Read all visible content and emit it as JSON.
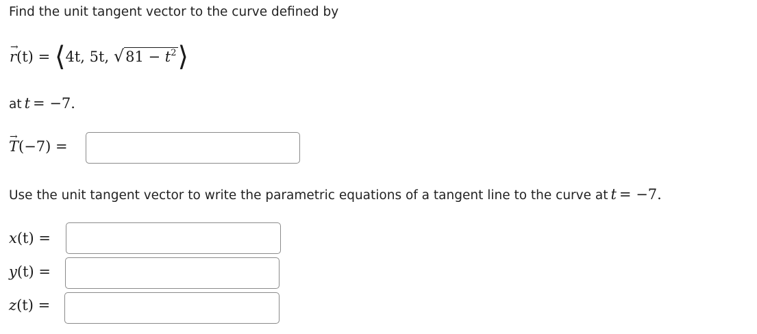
{
  "question": {
    "intro_text": "Find the unit tangent vector to the curve defined by",
    "curve": {
      "lhs_vec": "r",
      "lhs_arg": "(t)",
      "equals": "=",
      "comp1": "4t,",
      "comp2": "5t,",
      "radicand_const": "81 −",
      "radicand_var": "t",
      "radicand_exp": "2"
    },
    "at_text": "at",
    "at_var": "t",
    "at_value": "= −7.",
    "tangent_vec": "T",
    "tangent_arg": "(−7)",
    "tangent_equals": "="
  },
  "line_section": {
    "instruction_text": "Use the unit tangent vector to write the parametric equations of a tangent line to the curve at",
    "instruction_var": "t",
    "instruction_value": "= −7.",
    "rows": [
      {
        "var": "x",
        "arg": "(t)",
        "equals": "="
      },
      {
        "var": "y",
        "arg": "(t)",
        "equals": "="
      },
      {
        "var": "z",
        "arg": "(t)",
        "equals": "="
      }
    ]
  },
  "answers": {
    "tangent_value": "",
    "x_value": "",
    "y_value": "",
    "z_value": ""
  }
}
